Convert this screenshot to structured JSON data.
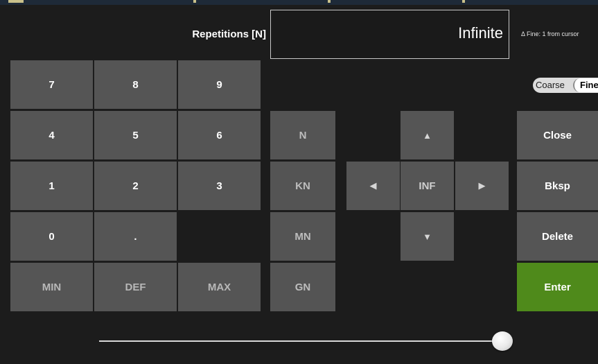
{
  "header": {
    "title": "Repetitions [N]",
    "value": "Infinite",
    "hint": "Δ Fine: 1 from cursor"
  },
  "step_toggle": {
    "options": [
      "Coarse",
      "Fine"
    ],
    "selected": "Fine"
  },
  "keypad": {
    "k7": "7",
    "k8": "8",
    "k9": "9",
    "k4": "4",
    "k5": "5",
    "k6": "6",
    "k1": "1",
    "k2": "2",
    "k3": "3",
    "k0": "0",
    "kdot": ".",
    "min": "MIN",
    "def": "DEF",
    "max": "MAX"
  },
  "units": {
    "n": "N",
    "kn": "KN",
    "mn": "MN",
    "gn": "GN"
  },
  "nav": {
    "up": "▲",
    "down": "▼",
    "left": "◀",
    "right": "▶",
    "center": "INF"
  },
  "actions": {
    "close": "Close",
    "bksp": "Bksp",
    "delete": "Delete",
    "enter": "Enter"
  },
  "colors": {
    "background": "#1c1c1c",
    "key": "#555555",
    "enter": "#4f8a1b"
  },
  "slider": {
    "value_fraction": 0.98
  }
}
